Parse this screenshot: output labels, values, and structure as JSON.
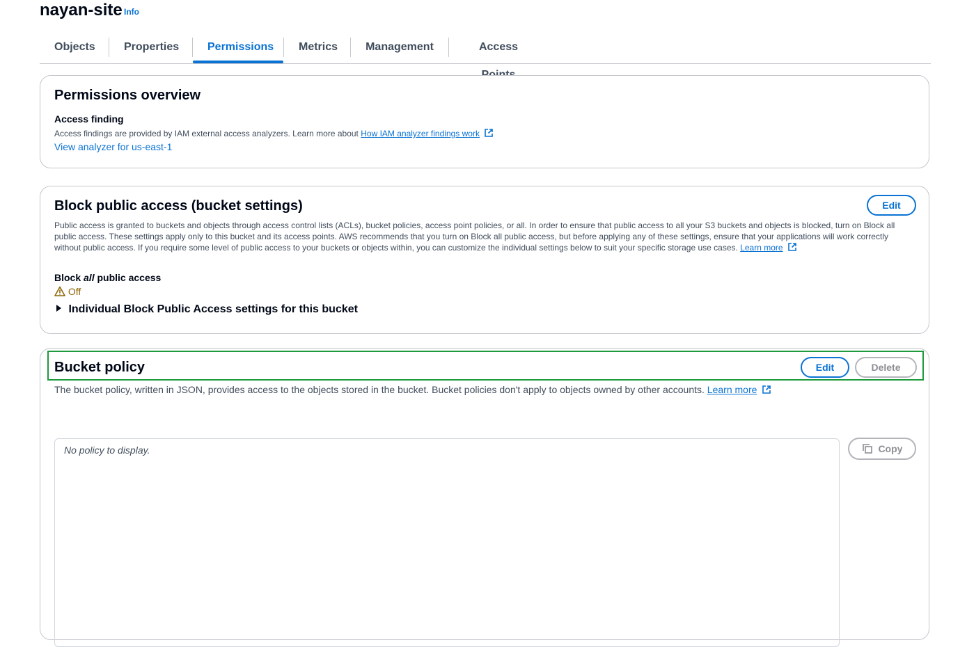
{
  "page": {
    "title": "nayan-site",
    "info_label": "Info"
  },
  "tabs": [
    {
      "label": "Objects"
    },
    {
      "label": "Properties"
    },
    {
      "label": "Permissions"
    },
    {
      "label": "Metrics"
    },
    {
      "label": "Management"
    },
    {
      "label": "Access Points"
    }
  ],
  "permissions_overview": {
    "heading": "Permissions overview",
    "access_finding_label": "Access finding",
    "description": "Access findings are provided by IAM external access analyzers. Learn more about",
    "help_link": "How IAM analyzer findings work",
    "analyzer_link": "View analyzer for us-east-1"
  },
  "block_public_access": {
    "heading": "Block public access (bucket settings)",
    "edit_label": "Edit",
    "description": "Public access is granted to buckets and objects through access control lists (ACLs), bucket policies, access point policies, or all. In order to ensure that public access to all your S3 buckets and objects is blocked, turn on Block all public access. These settings apply only to this bucket and its access points. AWS recommends that you turn on Block all public access, but before applying any of these settings, ensure that your applications will work correctly without public access. If you require some level of public access to your buckets or objects within, you can customize the individual settings below to suit your specific storage use cases.",
    "learn_more": "Learn more",
    "block_all_prefix": "Block",
    "block_all_emph": "all",
    "block_all_suffix": "public access",
    "status": "Off",
    "expander_label": "Individual Block Public Access settings for this bucket"
  },
  "bucket_policy": {
    "heading": "Bucket policy",
    "edit_label": "Edit",
    "delete_label": "Delete",
    "description": "The bucket policy, written in JSON, provides access to the objects stored in the bucket. Bucket policies don't apply to objects owned by other accounts.",
    "learn_more": "Learn more",
    "empty_text": "No policy to display.",
    "copy_label": "Copy"
  },
  "colors": {
    "link": "#0972d3",
    "highlight": "#1d9a3c",
    "warning": "#8d6605"
  }
}
